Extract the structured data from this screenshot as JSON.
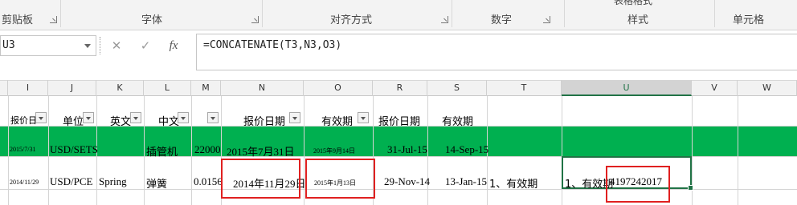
{
  "ribbon": {
    "groups": [
      {
        "label": "剪贴板"
      },
      {
        "label": "字体"
      },
      {
        "label": "对齐方式"
      },
      {
        "label": "数字"
      },
      {
        "label": "样式"
      },
      {
        "label": "单元格"
      }
    ],
    "partial_top": "表格格式"
  },
  "name_box": "U3",
  "formula_bar": {
    "cancel_glyph": "✕",
    "enter_glyph": "✓",
    "fx_glyph": "fx",
    "formula": "=CONCATENATE(T3,N3,O3)"
  },
  "columns": [
    "I",
    "J",
    "K",
    "L",
    "M",
    "N",
    "O",
    "R",
    "S",
    "T",
    "U",
    "V",
    "W"
  ],
  "selected_column": "U",
  "header_row": {
    "I": "报价日",
    "J": "单位",
    "K": "英文",
    "L": "中文",
    "M": "",
    "N": "报价日期",
    "O": "有效期",
    "R": "报价日期",
    "S": "有效期"
  },
  "row2": {
    "I": "2015/7/31",
    "J": "USD/SETS",
    "K": "",
    "L": "插管机",
    "M": "22000",
    "N": "2015年7月31日",
    "O": "2015年9月14日",
    "R": "31-Jul-15",
    "S": "14-Sep-15",
    "row_fill": "#00b050"
  },
  "row3": {
    "I": "2014/11/29",
    "J": "USD/PCE",
    "K": "Spring",
    "L": "弹簧",
    "M": "0.0156",
    "N": "2014年11月29日",
    "O": "2015年1月13日",
    "R": "29-Nov-14",
    "S": "13-Jan-15",
    "T": "1、有效期",
    "U_text": "1、有效期",
    "U_number": "4197242017"
  }
}
